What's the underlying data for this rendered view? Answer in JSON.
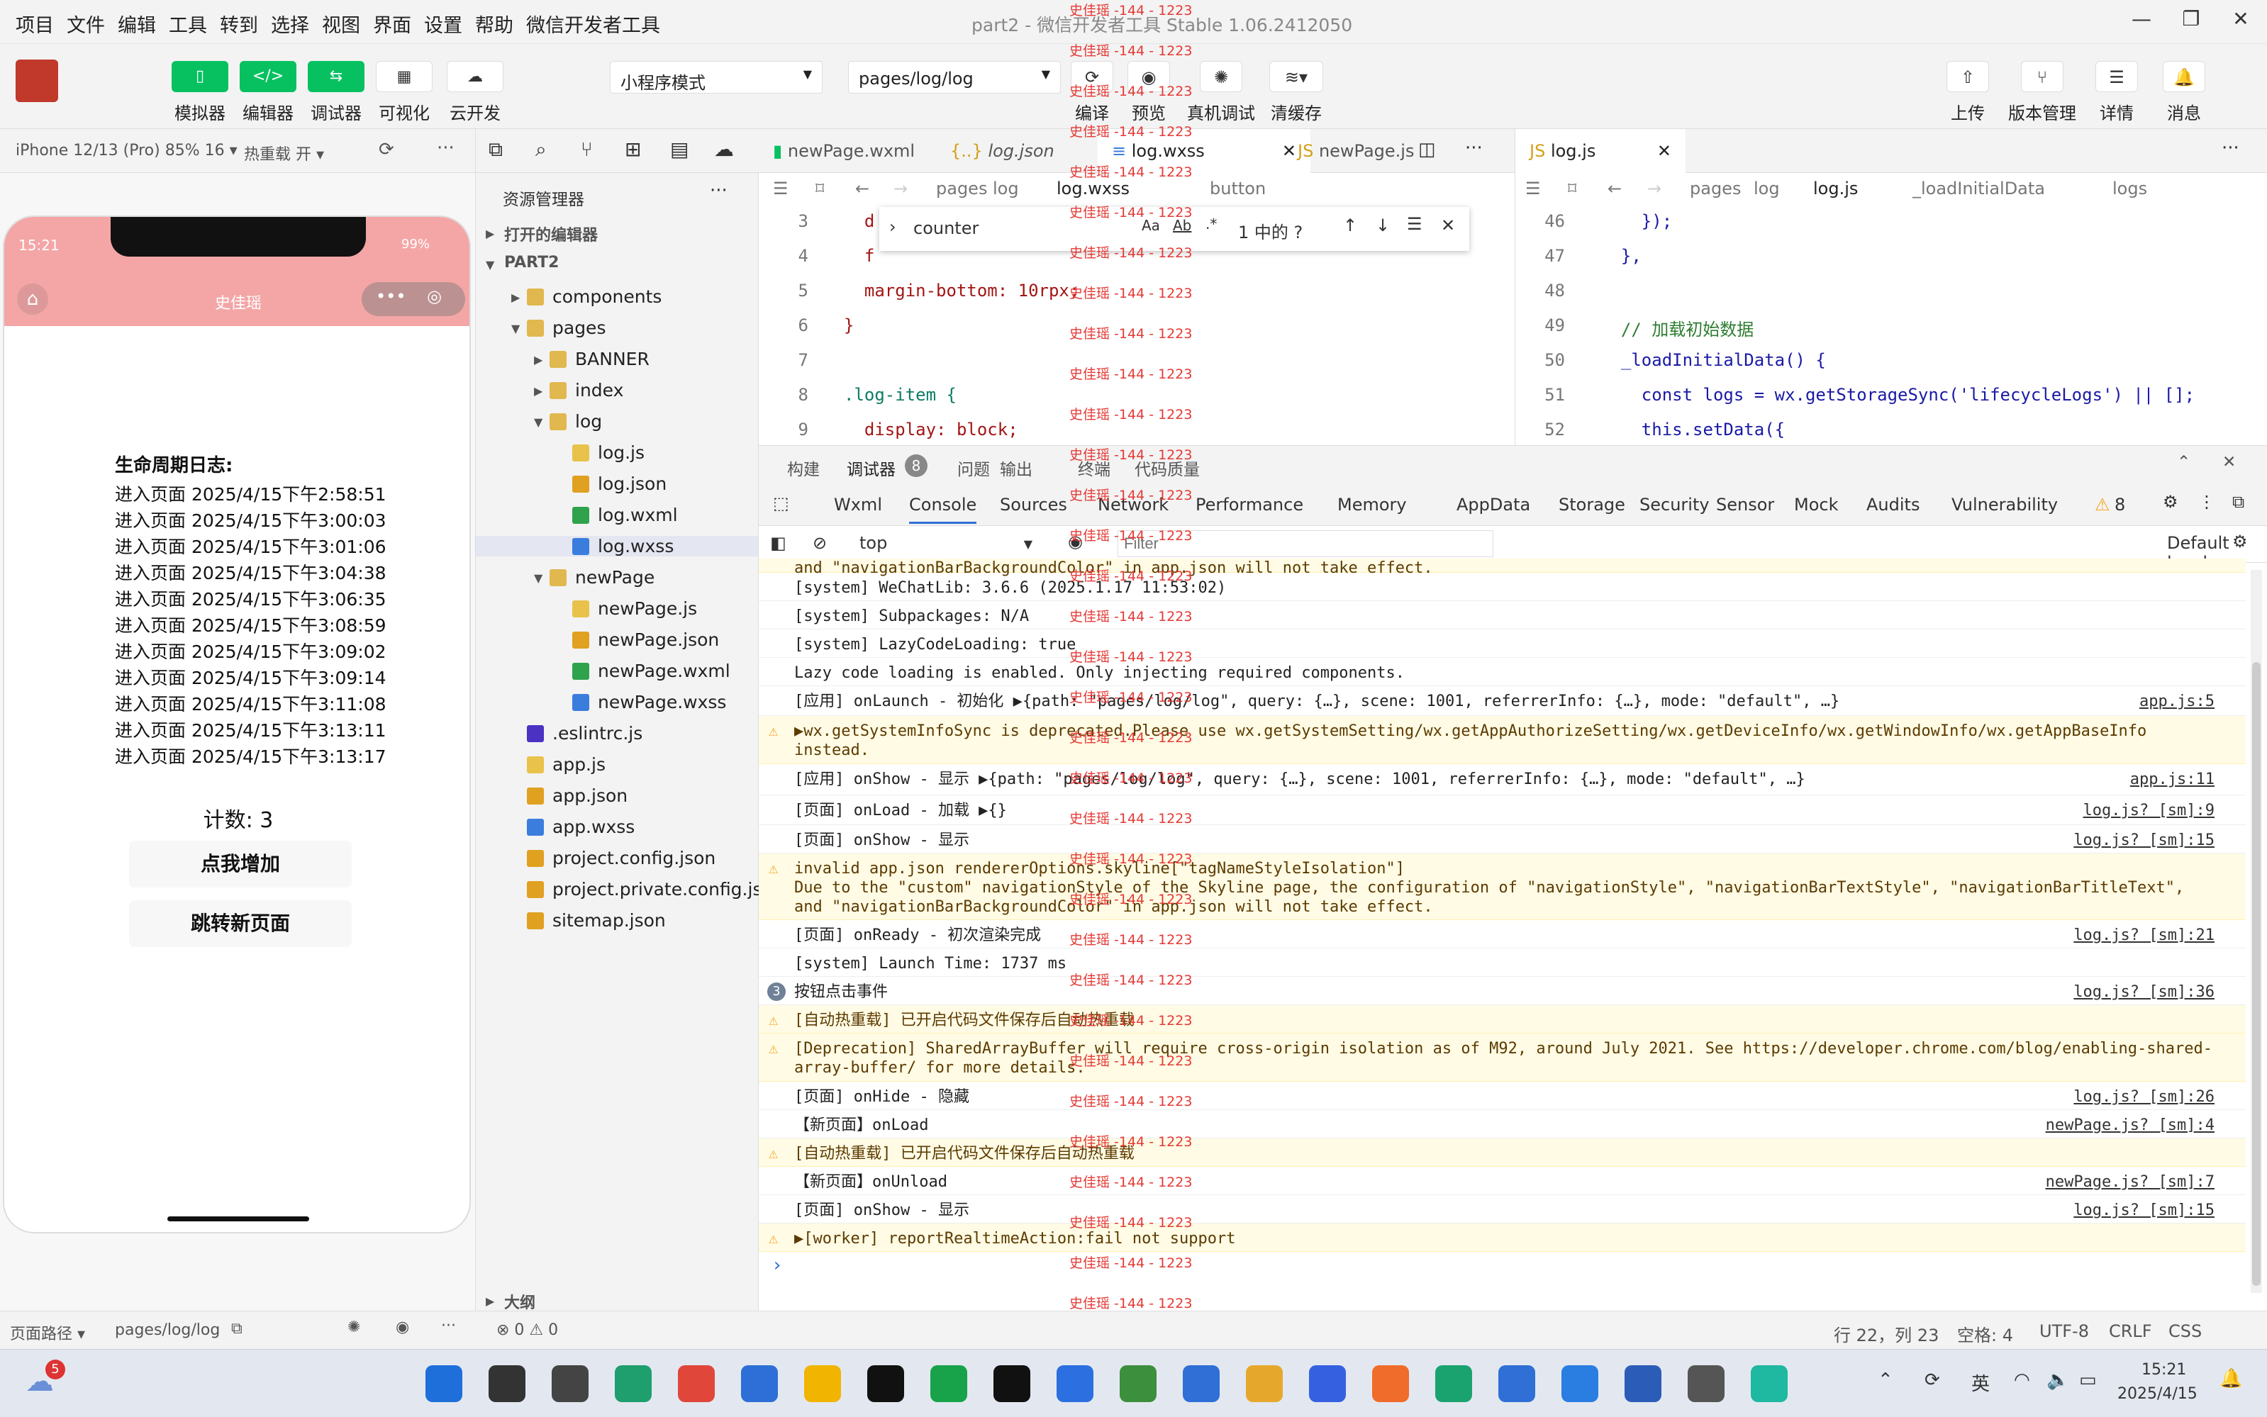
{
  "menu": [
    "项目",
    "文件",
    "编辑",
    "工具",
    "转到",
    "选择",
    "视图",
    "界面",
    "设置",
    "帮助",
    "微信开发者工具"
  ],
  "window_title": "part2 - 微信开发者工具 Stable 1.06.2412050",
  "toolbar": {
    "left_buttons": [
      "模拟器",
      "编辑器",
      "调试器",
      "可视化",
      "云开发"
    ],
    "mode_select": "小程序模式",
    "page_select": "pages/log/log",
    "mid_buttons": [
      "编译",
      "预览",
      "真机调试",
      "清缓存"
    ],
    "right_buttons": [
      "上传",
      "版本管理",
      "详情",
      "消息"
    ]
  },
  "simulator": {
    "device": "iPhone 12/13 (Pro) 85% 16 ▾",
    "hot_reload": "热重载 开 ▾",
    "time": "15:21",
    "battery": "99%",
    "nav_title": "史佳瑶",
    "log_title": "生命周期日志:",
    "log_entries": [
      "进入页面 2025/4/15下午2:58:51",
      "进入页面 2025/4/15下午3:00:03",
      "进入页面 2025/4/15下午3:01:06",
      "进入页面 2025/4/15下午3:04:38",
      "进入页面 2025/4/15下午3:06:35",
      "进入页面 2025/4/15下午3:08:59",
      "进入页面 2025/4/15下午3:09:02",
      "进入页面 2025/4/15下午3:09:14",
      "进入页面 2025/4/15下午3:11:08",
      "进入页面 2025/4/15下午3:13:11",
      "进入页面 2025/4/15下午3:13:17"
    ],
    "counter": "计数: 3",
    "btn_add": "点我增加",
    "btn_jump": "跳转新页面"
  },
  "status_left": {
    "path_label": "页面路径 ▾",
    "path": "pages/log/log"
  },
  "explorer": {
    "title": "资源管理器",
    "open_editors": "打开的编辑器",
    "project": "PART2",
    "outline": "大纲",
    "items": [
      {
        "label": "components",
        "kind": "folder"
      },
      {
        "label": "pages",
        "kind": "folder"
      },
      {
        "label": "BANNER",
        "kind": "folder"
      },
      {
        "label": "index",
        "kind": "folder"
      },
      {
        "label": "log",
        "kind": "folder"
      },
      {
        "label": "log.js",
        "kind": "js"
      },
      {
        "label": "log.json",
        "kind": "json"
      },
      {
        "label": "log.wxml",
        "kind": "wxml"
      },
      {
        "label": "log.wxss",
        "kind": "wxss"
      },
      {
        "label": "newPage",
        "kind": "folder"
      },
      {
        "label": "newPage.js",
        "kind": "js"
      },
      {
        "label": "newPage.json",
        "kind": "json"
      },
      {
        "label": "newPage.wxml",
        "kind": "wxml"
      },
      {
        "label": "newPage.wxss",
        "kind": "wxss"
      },
      {
        "label": ".eslintrc.js",
        "kind": "eslint"
      },
      {
        "label": "app.js",
        "kind": "js"
      },
      {
        "label": "app.json",
        "kind": "json"
      },
      {
        "label": "app.wxss",
        "kind": "wxss"
      },
      {
        "label": "project.config.json",
        "kind": "json"
      },
      {
        "label": "project.private.config.js...",
        "kind": "json"
      },
      {
        "label": "sitemap.json",
        "kind": "json"
      }
    ]
  },
  "editor_tabs": [
    "newPage.wxml",
    "log.json",
    "log.wxss",
    "newPage.js"
  ],
  "editor_breadcrumb": [
    "pages",
    "log",
    "log.wxss",
    "button"
  ],
  "find": {
    "query": "counter",
    "result": "1 中的 ?"
  },
  "editor_lines": [
    {
      "n": "3",
      "code": "  d"
    },
    {
      "n": "4",
      "code": "  f"
    },
    {
      "n": "5",
      "code": "  margin-bottom: 10rpx;"
    },
    {
      "n": "6",
      "code": "}"
    },
    {
      "n": "7",
      "code": ""
    },
    {
      "n": "8",
      "code": ".log-item {"
    },
    {
      "n": "9",
      "code": "  display: block;"
    }
  ],
  "editor2_tab": "log.js",
  "editor2_breadcrumb": [
    "pages",
    "log",
    "log.js",
    "_loadInitialData",
    "logs"
  ],
  "editor2_lines": [
    {
      "n": "46",
      "code": "    });"
    },
    {
      "n": "47",
      "code": "  },"
    },
    {
      "n": "48",
      "code": ""
    },
    {
      "n": "49",
      "code": "  // 加载初始数据"
    },
    {
      "n": "50",
      "code": "  _loadInitialData() {"
    },
    {
      "n": "51",
      "code": "    const logs = wx.getStorageSync('lifecycleLogs') || [];"
    },
    {
      "n": "52",
      "code": "    this.setData({"
    }
  ],
  "devtools": {
    "top_tabs": [
      "构建",
      "调试器",
      "问题",
      "输出",
      "终端",
      "代码质量"
    ],
    "badge": "8",
    "panel_tabs": [
      "Wxml",
      "Console",
      "Sources",
      "Network",
      "Performance",
      "Memory",
      "AppData",
      "Storage",
      "Security",
      "Sensor",
      "Mock",
      "Audits",
      "Vulnerability"
    ],
    "warn_count": "8",
    "context": "top",
    "filter_placeholder": "Filter",
    "levels": "Default levels ▾"
  },
  "console": [
    {
      "text": "and \"navigationBarBackgroundColor\" in app.json will not take effect.",
      "type": "warn",
      "src": "",
      "h": 20
    },
    {
      "text": "[system] WeChatLib: 3.6.6 (2025.1.17 11:53:02)",
      "type": "log",
      "src": "",
      "h": 40
    },
    {
      "text": "[system] Subpackages: N/A",
      "type": "log",
      "src": "",
      "h": 40
    },
    {
      "text": "[system] LazyCodeLoading: true",
      "type": "log",
      "src": "",
      "h": 40
    },
    {
      "text": "Lazy code loading is enabled. Only injecting required components.",
      "type": "log",
      "src": "",
      "h": 40
    },
    {
      "text": "[应用] onLaunch - 初始化 ▶{path: \"pages/log/log\", query: {…}, scene: 1001, referrerInfo: {…}, mode: \"default\", …}",
      "type": "log",
      "src": "app.js:5",
      "h": 42
    },
    {
      "text": "▶wx.getSystemInfoSync is deprecated.Please use wx.getSystemSetting/wx.getAppAuthorizeSetting/wx.getDeviceInfo/wx.getWindowInfo/wx.getAppBaseInfo\ninstead.",
      "type": "warn",
      "src": "",
      "h": 68
    },
    {
      "text": "[应用] onShow - 显示 ▶{path: \"pages/log/log\", query: {…}, scene: 1001, referrerInfo: {…}, mode: \"default\", …}",
      "type": "log",
      "src": "app.js:11",
      "h": 44
    },
    {
      "text": "[页面] onLoad - 加载 ▶{}",
      "type": "log",
      "src": "log.js? [sm]:9",
      "h": 42
    },
    {
      "text": "[页面] onShow - 显示",
      "type": "log",
      "src": "log.js? [sm]:15",
      "h": 40
    },
    {
      "text": "invalid app.json rendererOptions.skyline[\"tagNameStyleIsolation\"]\nDue to the \"custom\" navigationStyle of the Skyline page, the configuration of \"navigationStyle\", \"navigationBarTextStyle\", \"navigationBarTitleText\",\nand \"navigationBarBackgroundColor\" in app.json will not take effect.",
      "type": "warn",
      "src": "",
      "h": 94
    },
    {
      "text": "[页面] onReady - 初次渲染完成",
      "type": "log",
      "src": "log.js? [sm]:21",
      "h": 40
    },
    {
      "text": "[system] Launch Time: 1737 ms",
      "type": "log",
      "src": "",
      "h": 40
    },
    {
      "text": "按钮点击事件",
      "type": "count",
      "src": "log.js? [sm]:36",
      "h": 40
    },
    {
      "text": "[自动热重载] 已开启代码文件保存后自动热重载",
      "type": "warn",
      "src": "",
      "h": 40
    },
    {
      "text": "[Deprecation] SharedArrayBuffer will require cross-origin isolation as of M92, around July 2021. See https://developer.chrome.com/blog/enabling-shared-\narray-buffer/ for more details.",
      "type": "warn",
      "src": "",
      "h": 68
    },
    {
      "text": "[页面] onHide - 隐藏",
      "type": "log",
      "src": "log.js? [sm]:26",
      "h": 40
    },
    {
      "text": "【新页面】onLoad",
      "type": "log",
      "src": "newPage.js? [sm]:4",
      "h": 40
    },
    {
      "text": "[自动热重载] 已开启代码文件保存后自动热重载",
      "type": "warn",
      "src": "",
      "h": 40
    },
    {
      "text": "【新页面】onUnload",
      "type": "log",
      "src": "newPage.js? [sm]:7",
      "h": 40
    },
    {
      "text": "[页面] onShow - 显示",
      "type": "log",
      "src": "log.js? [sm]:15",
      "h": 40
    },
    {
      "text": "▶[worker] reportRealtimeAction:fail not support",
      "type": "warn",
      "src": "",
      "h": 40
    }
  ],
  "count_badge": "3",
  "overlay_text": "史佳瑶 -144 - 1223",
  "status_right": {
    "errors": "⊗ 0 ⚠ 0",
    "position": "行 22，列 23",
    "spaces": "空格: 4",
    "encoding": "UTF-8",
    "eol": "CRLF",
    "lang": "CSS"
  },
  "taskbar": {
    "time": "15:21",
    "date": "2025/4/15",
    "lang": "英",
    "weather_badge": "5"
  }
}
